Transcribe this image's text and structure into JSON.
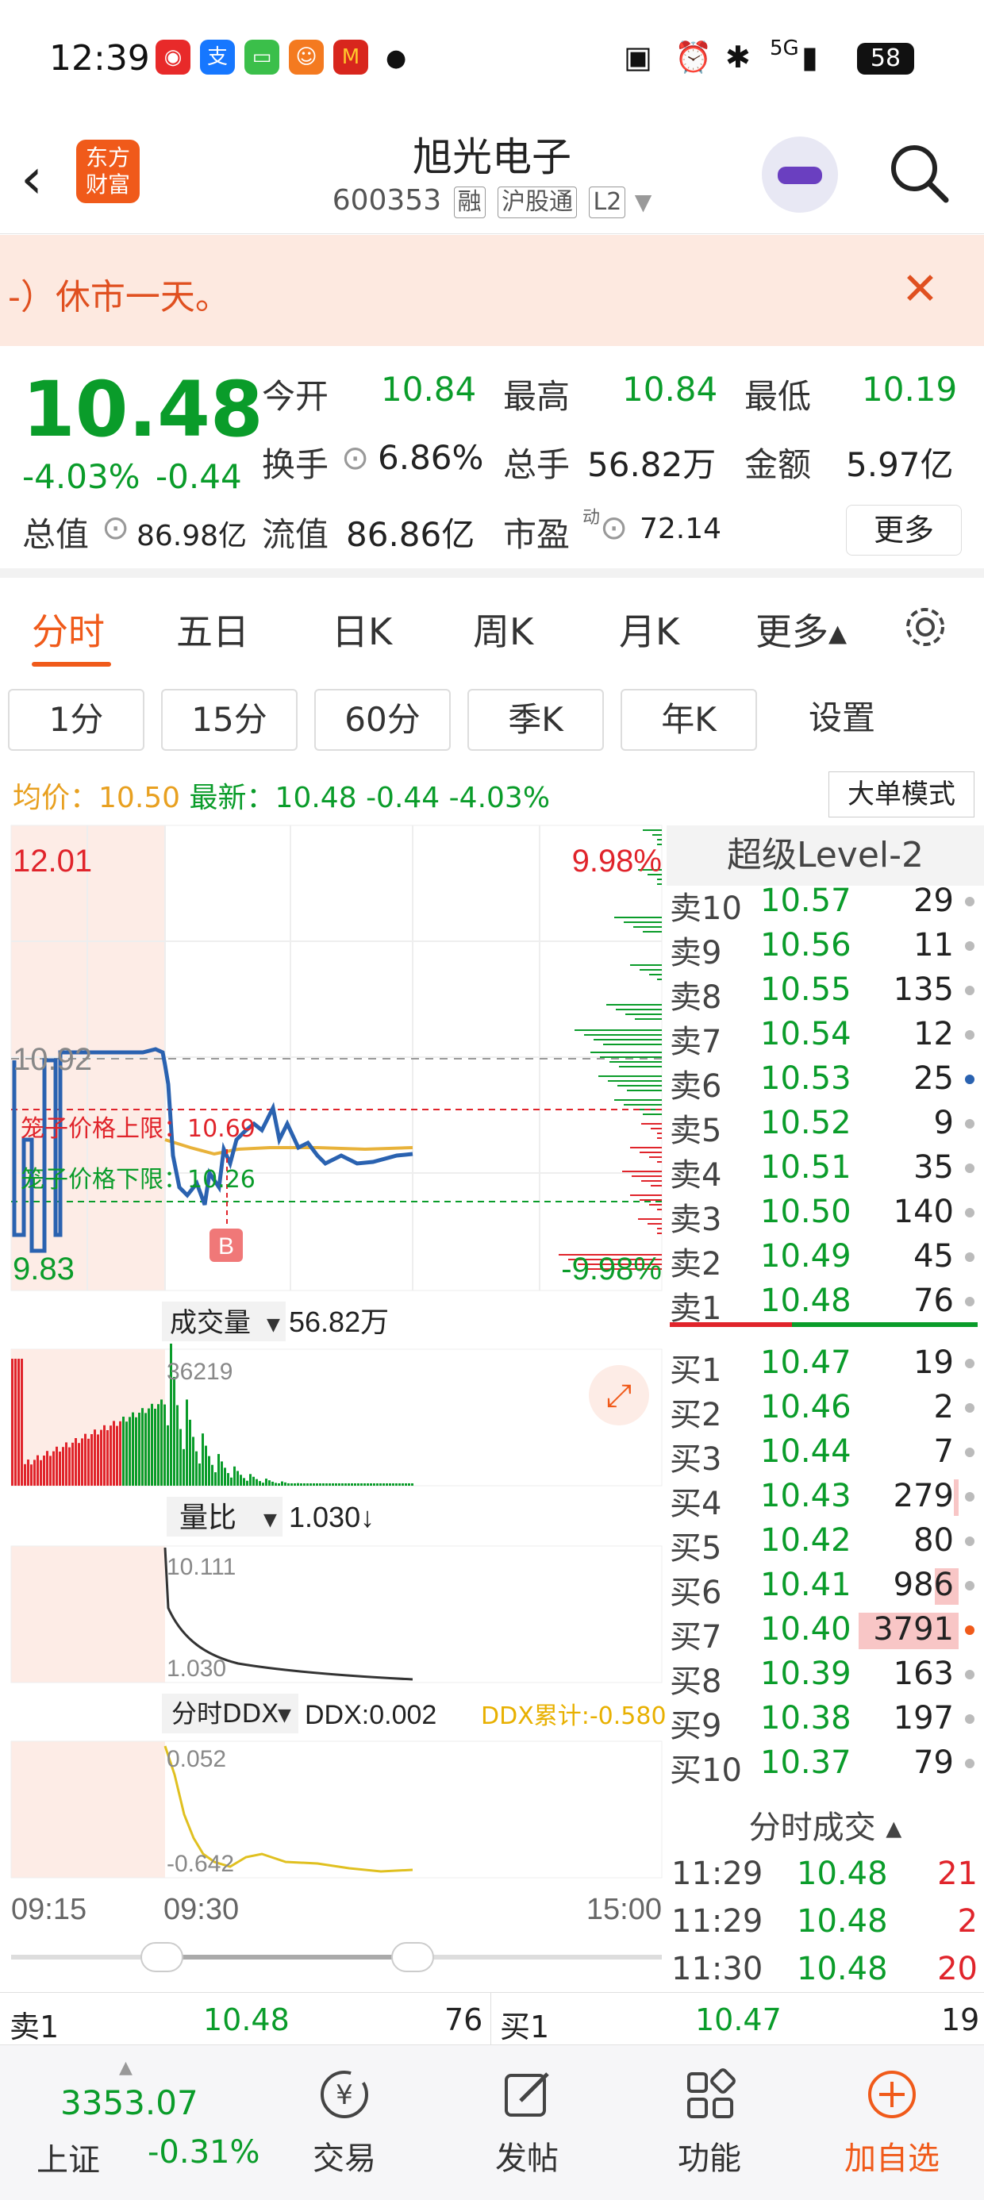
{
  "status_bar": {
    "time": "12:39",
    "battery": "58",
    "signal": "5G"
  },
  "header": {
    "title": "旭光电子",
    "code": "600353",
    "tags": [
      "融",
      "沪股通",
      "L2"
    ],
    "logo_text_1": "东方",
    "logo_text_2": "财富"
  },
  "notice": {
    "text": "-）休市一天。"
  },
  "quote": {
    "price": "10.48",
    "change_pct": "-4.03%",
    "change_abs": "-0.44",
    "open_label": "今开",
    "open": "10.84",
    "high_label": "最高",
    "high": "10.84",
    "low_label": "最低",
    "low": "10.19",
    "turnover_label": "换手",
    "turnover": "6.86%",
    "volume_label": "总手",
    "volume": "56.82万",
    "amount_label": "金额",
    "amount": "5.97亿",
    "mktcap_label": "总值",
    "mktcap": "86.98亿",
    "float_label": "流值",
    "float": "86.86亿",
    "pe_label": "市盈",
    "pe_sup": "动",
    "pe": "72.14",
    "more": "更多"
  },
  "tabs": [
    "分时",
    "五日",
    "日K",
    "周K",
    "月K",
    "更多▴"
  ],
  "periods": [
    "1分",
    "15分",
    "60分",
    "季K",
    "年K",
    "设置"
  ],
  "avg_row": {
    "avg_label": "均价：",
    "avg": "10.50",
    "latest_label": "最新：",
    "latest": "10.48",
    "chg": "-0.44",
    "pct": "-4.03%"
  },
  "big_order_mode": "大单模式",
  "chart": {
    "y_high": "12.01",
    "y_low": "9.83",
    "pct_high": "9.98%",
    "pct_low": "-9.98%",
    "prev_close": "10.92",
    "cage_up_label": "笼子价格上限：10.69",
    "cage_down_label": "笼子价格下限：10.26",
    "b_marker": "B",
    "vol_title": "成交量",
    "vol_value": "56.82万",
    "vol_max": "36219",
    "ratio_title": "量比",
    "ratio_value": "1.030↓",
    "ratio_max": "10.111",
    "ratio_min": "1.030",
    "ddx_title": "分时DDX",
    "ddx_value": "DDX:0.002",
    "ddx_cum": "DDX累计:-0.580",
    "ddx_max": "0.052",
    "ddx_min": "-0.642",
    "t_start": "09:15",
    "t_open": "09:30",
    "t_end": "15:00"
  },
  "orderbook": {
    "title": "超级Level-2",
    "sell": [
      {
        "label": "卖10",
        "price": "10.57",
        "vol": "29"
      },
      {
        "label": "卖9",
        "price": "10.56",
        "vol": "11"
      },
      {
        "label": "卖8",
        "price": "10.55",
        "vol": "135"
      },
      {
        "label": "卖7",
        "price": "10.54",
        "vol": "12"
      },
      {
        "label": "卖6",
        "price": "10.53",
        "vol": "25"
      },
      {
        "label": "卖5",
        "price": "10.52",
        "vol": "9"
      },
      {
        "label": "卖4",
        "price": "10.51",
        "vol": "35"
      },
      {
        "label": "卖3",
        "price": "10.50",
        "vol": "140"
      },
      {
        "label": "卖2",
        "price": "10.49",
        "vol": "45"
      },
      {
        "label": "卖1",
        "price": "10.48",
        "vol": "76"
      }
    ],
    "buy": [
      {
        "label": "买1",
        "price": "10.47",
        "vol": "19"
      },
      {
        "label": "买2",
        "price": "10.46",
        "vol": "2"
      },
      {
        "label": "买3",
        "price": "10.44",
        "vol": "7"
      },
      {
        "label": "买4",
        "price": "10.43",
        "vol": "279"
      },
      {
        "label": "买5",
        "price": "10.42",
        "vol": "80"
      },
      {
        "label": "买6",
        "price": "10.41",
        "vol": "986"
      },
      {
        "label": "买7",
        "price": "10.40",
        "vol": "3791"
      },
      {
        "label": "买8",
        "price": "10.39",
        "vol": "163"
      },
      {
        "label": "买9",
        "price": "10.38",
        "vol": "197"
      },
      {
        "label": "买10",
        "price": "10.37",
        "vol": "79"
      }
    ]
  },
  "trades": {
    "title": "分时成交 ▴",
    "rows": [
      {
        "time": "11:29",
        "price": "10.48",
        "vol": "21"
      },
      {
        "time": "11:29",
        "price": "10.48",
        "vol": "2"
      },
      {
        "time": "11:30",
        "price": "10.48",
        "vol": "20"
      }
    ]
  },
  "strip": {
    "sell_label": "卖1",
    "sell_price": "10.48",
    "sell_vol": "76",
    "buy_label": "买1",
    "buy_price": "10.47",
    "buy_vol": "19"
  },
  "bottom_nav": {
    "index_value": "3353.07",
    "index_name": "上证",
    "index_pct": "-0.31%",
    "trade": "交易",
    "post": "发帖",
    "func": "功能",
    "add": "加自选"
  },
  "colors": {
    "up": "#e0242b",
    "down": "#0a9c2a",
    "brand": "#f05a1a",
    "price_line": "#2a62b0",
    "avg_line": "#e8b23a"
  }
}
